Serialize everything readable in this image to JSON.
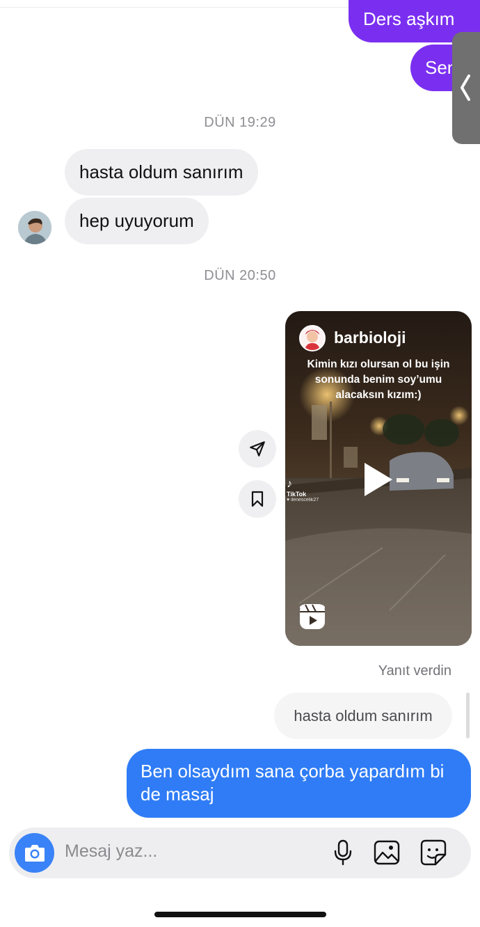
{
  "messages": {
    "top_out_1": "Ders aşkım",
    "top_out_2": "Sen",
    "timestamp_1": "DÜN 19:29",
    "in_1": "hasta oldum sanırım",
    "in_2": "hep uyuyorum",
    "timestamp_2": "DÜN 20:50",
    "reel": {
      "username": "barbioloji",
      "caption": "Kimin kızı olursan ol bu işin\nsonunda benim soy’umu\nalacaksın kızım:)",
      "watermark": "TikTok",
      "watermark_user": "♥ ilenescelik27"
    },
    "replied_label": "Yanıt verdin",
    "quoted_text": "hasta oldum sanırım",
    "out_reply": "Ben olsaydım sana çorba yapardım bi de masaj"
  },
  "composer": {
    "placeholder": "Mesaj yaz..."
  },
  "icons": {
    "camera": "camera-icon",
    "microphone": "microphone-icon",
    "gallery": "gallery-icon",
    "sticker": "sticker-icon",
    "share": "share-icon",
    "bookmark": "bookmark-icon",
    "reels": "reels-icon",
    "side_handle": "chevron-left-icon"
  },
  "colors": {
    "outgoing_purple": "#7a2ff0",
    "outgoing_blue": "#2f7cf6",
    "incoming_gray": "#efeff1",
    "camera_blue": "#3a82f7"
  }
}
